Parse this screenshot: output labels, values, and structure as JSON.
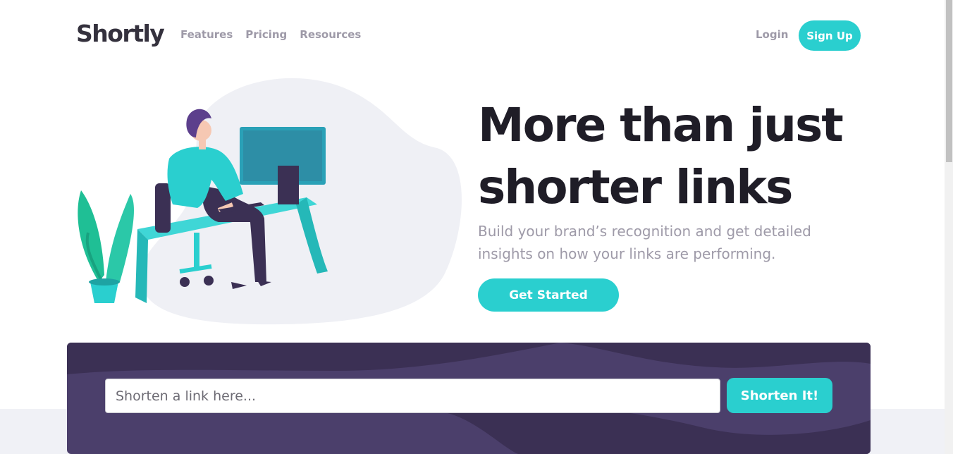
{
  "header": {
    "logo": "Shortly",
    "nav": [
      "Features",
      "Pricing",
      "Resources"
    ],
    "login": "Login",
    "signup": "Sign Up"
  },
  "hero": {
    "title_line1": "More than just",
    "title_line2": "shorter links",
    "subtitle_line1": "Build your brand’s recognition and get detailed",
    "subtitle_line2": "insights on how your links are performing.",
    "cta": "Get Started",
    "illustration_icon": "person-working-at-desk-illustration"
  },
  "shorten": {
    "placeholder": "Shorten a link here...",
    "value": "",
    "button": "Shorten It!"
  },
  "colors": {
    "accent": "#2acfcf",
    "dark_violet": "#3b3054",
    "box_violet": "#4b3f6b",
    "gray_text": "#9e9aa8",
    "heading": "#1f1d27"
  }
}
